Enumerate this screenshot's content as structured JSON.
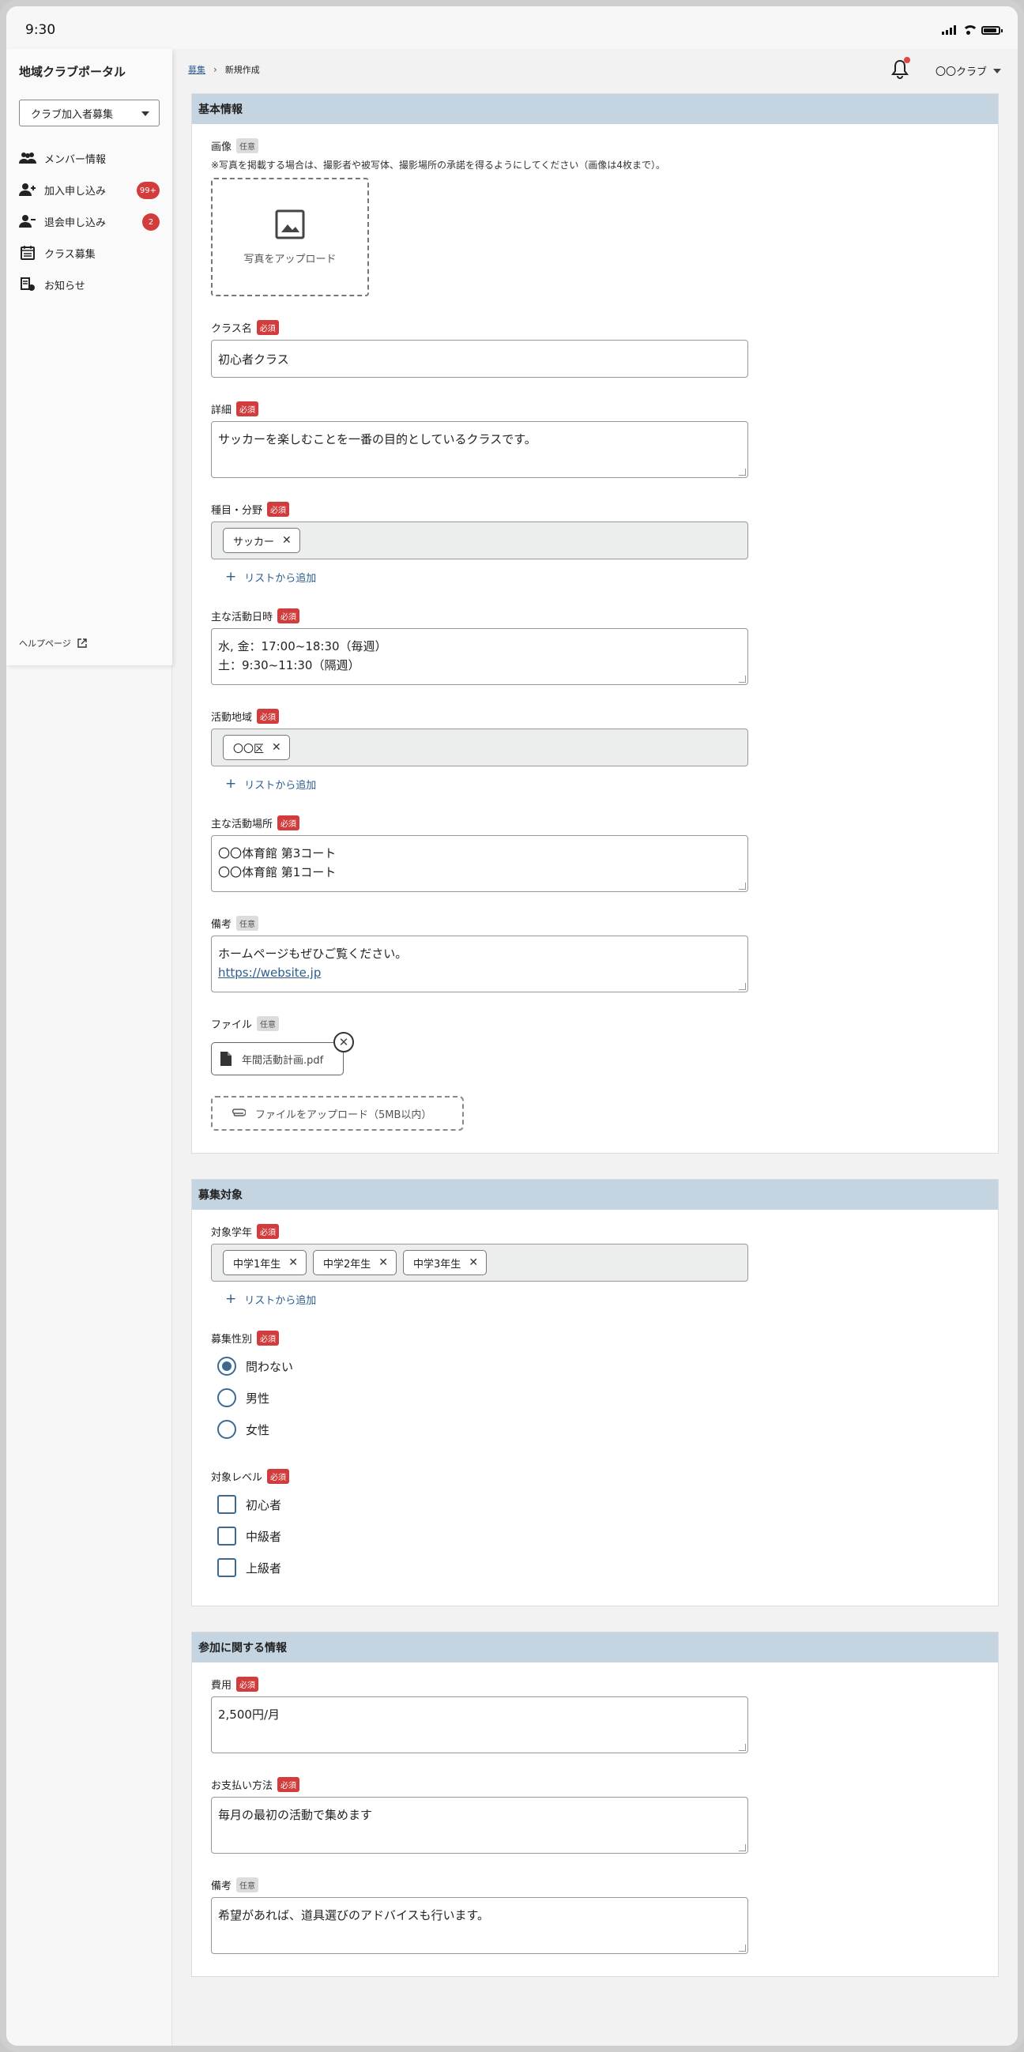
{
  "status": {
    "time": "9:30"
  },
  "sidebar": {
    "app_title": "地域クラブポータル",
    "club_select": "クラブ加入者募集",
    "items": [
      {
        "label": "メンバー情報",
        "icon": "people-icon"
      },
      {
        "label": "加入申し込み",
        "icon": "person-add-icon",
        "badge": "99+"
      },
      {
        "label": "退会申し込み",
        "icon": "person-remove-icon",
        "badge": "2"
      },
      {
        "label": "クラス募集",
        "icon": "calendar-icon"
      },
      {
        "label": "お知らせ",
        "icon": "announcement-icon"
      }
    ],
    "help": "ヘルプページ"
  },
  "header": {
    "breadcrumb": [
      "募集",
      "新規作成"
    ],
    "user": "〇〇クラブ"
  },
  "tags": {
    "required": "必須",
    "optional": "任意"
  },
  "basic": {
    "title": "基本情報",
    "image_label": "画像",
    "image_note": "※写真を掲載する場合は、撮影者や被写体、撮影場所の承諾を得るようにしてください（画像は4枚まで）。",
    "upload_photo": "写真をアップロード",
    "class_name_label": "クラス名",
    "class_name_value": "初心者クラス",
    "detail_label": "詳細",
    "detail_value": "サッカーを楽しむことを一番の目的としているクラスです。",
    "category_label": "種目・分野",
    "category_chips": [
      "サッカー"
    ],
    "add_from_list": "リストから追加",
    "schedule_label": "主な活動日時",
    "schedule_lines": [
      "水, 金：17:00~18:30（毎週）",
      "土：9:30~11:30（隔週）"
    ],
    "area_label": "活動地域",
    "area_chips": [
      "〇〇区"
    ],
    "place_label": "主な活動場所",
    "place_lines": [
      "〇〇体育館 第3コート",
      "〇〇体育館 第1コート"
    ],
    "remarks_label": "備考",
    "remarks_text": "ホームページもぜひご覧ください。",
    "remarks_link": "https://website.jp",
    "file_label": "ファイル",
    "file_name": "年間活動計画.pdf",
    "file_upload": "ファイルをアップロード（5MB以内）"
  },
  "target": {
    "title": "募集対象",
    "grade_label": "対象学年",
    "grade_chips": [
      "中学1年生",
      "中学2年生",
      "中学3年生"
    ],
    "gender_label": "募集性別",
    "gender_options": [
      "問わない",
      "男性",
      "女性"
    ],
    "gender_selected": 0,
    "level_label": "対象レベル",
    "level_options": [
      "初心者",
      "中級者",
      "上級者"
    ]
  },
  "join": {
    "title": "参加に関する情報",
    "fee_label": "費用",
    "fee_value": "2,500円/月",
    "payment_label": "お支払い方法",
    "payment_value": "毎月の最初の活動で集めます",
    "remarks_label": "備考",
    "remarks_value": "希望があれば、道具選びのアドバイスも行います。"
  },
  "colors": {
    "accent": "#3a6a94",
    "header_band": "#c4d4e1",
    "required_tag": "#d23c3c",
    "link": "#2c5d8f"
  }
}
